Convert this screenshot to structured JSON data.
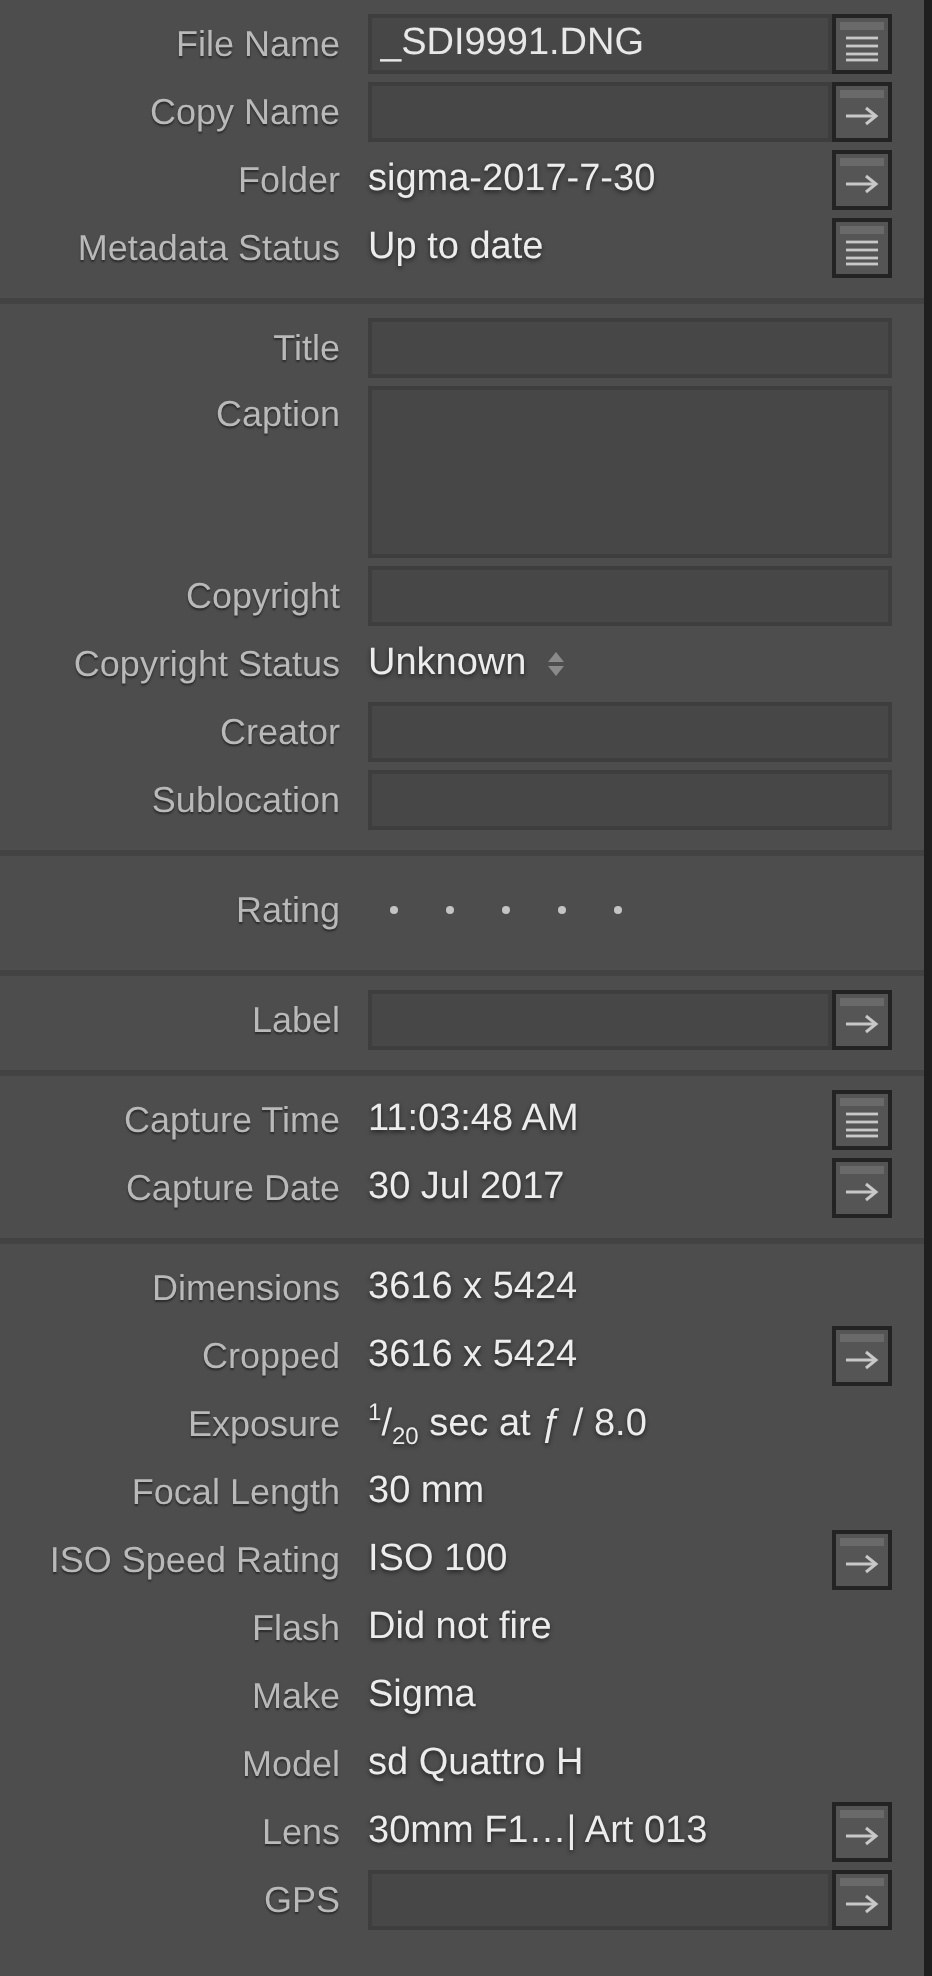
{
  "sections": [
    {
      "rows": [
        {
          "label": "File Name",
          "kind": "field",
          "value": "_SDI9991.DNG",
          "button": {
            "kind": "list"
          }
        },
        {
          "label": "Copy Name",
          "kind": "field",
          "button": {
            "kind": "arrow"
          }
        },
        {
          "label": "Folder",
          "kind": "text",
          "value": "sigma-2017-7-30",
          "button": {
            "kind": "arrow"
          }
        },
        {
          "label": "Metadata Status",
          "kind": "text",
          "value": "Up to date",
          "button": {
            "kind": "list"
          }
        }
      ]
    },
    {
      "rows": [
        {
          "label": "Title",
          "kind": "field"
        },
        {
          "label": "Caption",
          "kind": "textarea"
        },
        {
          "label": "Copyright",
          "kind": "field"
        },
        {
          "label": "Copyright Status",
          "kind": "popup",
          "value": "Unknown"
        },
        {
          "label": "Creator",
          "kind": "field"
        },
        {
          "label": "Sublocation",
          "kind": "field"
        }
      ]
    },
    {
      "rows": [
        {
          "label": "Rating",
          "kind": "rating"
        }
      ]
    },
    {
      "rows": [
        {
          "label": "Label",
          "kind": "field",
          "button": {
            "kind": "arrow"
          }
        }
      ]
    },
    {
      "rows": [
        {
          "label": "Capture Time",
          "kind": "text",
          "value": "11:03:48 AM",
          "button": {
            "kind": "list"
          }
        },
        {
          "label": "Capture Date",
          "kind": "text",
          "value": "30 Jul 2017",
          "button": {
            "kind": "arrow"
          }
        }
      ]
    },
    {
      "rows": [
        {
          "label": "Dimensions",
          "kind": "text",
          "value": "3616 x 5424"
        },
        {
          "label": "Cropped",
          "kind": "text",
          "value": "3616 x 5424",
          "button": {
            "kind": "arrow"
          }
        },
        {
          "label": "Exposure",
          "kind": "text",
          "value": "$^{1}$/$_{20}$ sec at ƒ / 8.0"
        },
        {
          "label": "Focal Length",
          "kind": "text",
          "value": "30 mm"
        },
        {
          "label": "ISO Speed Rating",
          "kind": "text",
          "value": "ISO 100",
          "button": {
            "kind": "arrow"
          }
        },
        {
          "label": "Flash",
          "kind": "text",
          "value": "Did not fire"
        },
        {
          "label": "Make",
          "kind": "text",
          "value": "Sigma"
        },
        {
          "label": "Model",
          "kind": "text",
          "value": "sd Quattro H"
        },
        {
          "label": "Lens",
          "kind": "text",
          "value": "30mm F1…| Art 013",
          "button": {
            "kind": "arrow"
          }
        },
        {
          "label": "GPS",
          "kind": "field",
          "button": {
            "kind": "arrow"
          }
        }
      ]
    }
  ]
}
